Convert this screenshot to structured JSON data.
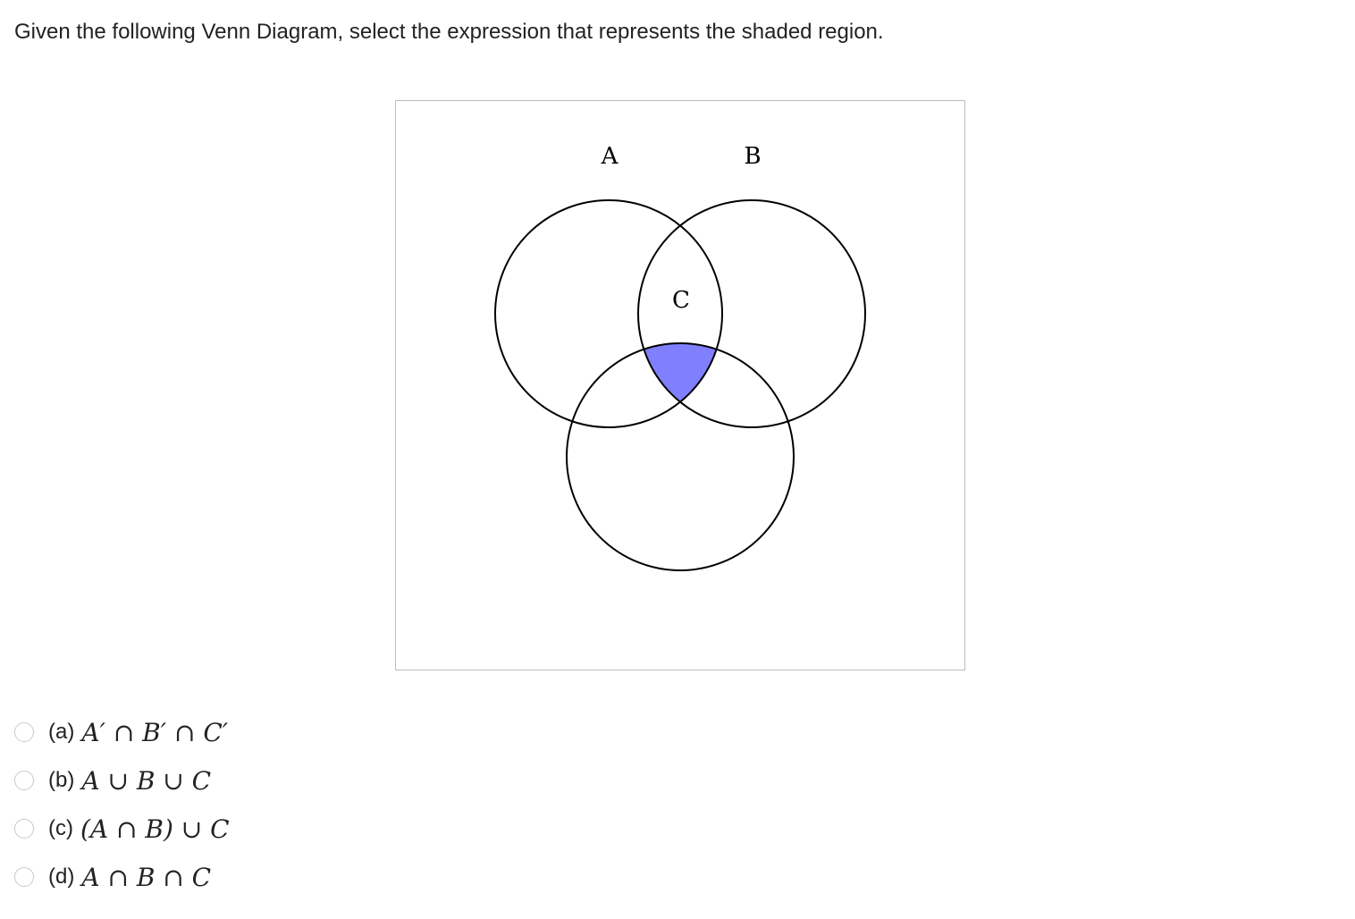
{
  "question": {
    "text": "Given the following Venn Diagram, select the expression that represents the shaded region."
  },
  "diagram": {
    "labels": {
      "a": "A",
      "b": "B",
      "c": "C"
    },
    "shade_color": "#8080ff",
    "stroke_color": "#000000"
  },
  "options": [
    {
      "label": "(a)",
      "expression": "A′ ∩ B′ ∩ C′"
    },
    {
      "label": "(b)",
      "expression": "A ∪ B ∪ C"
    },
    {
      "label": "(c)",
      "expression": "(A ∩ B) ∪ C"
    },
    {
      "label": "(d)",
      "expression": "A ∩ B ∩ C"
    }
  ]
}
